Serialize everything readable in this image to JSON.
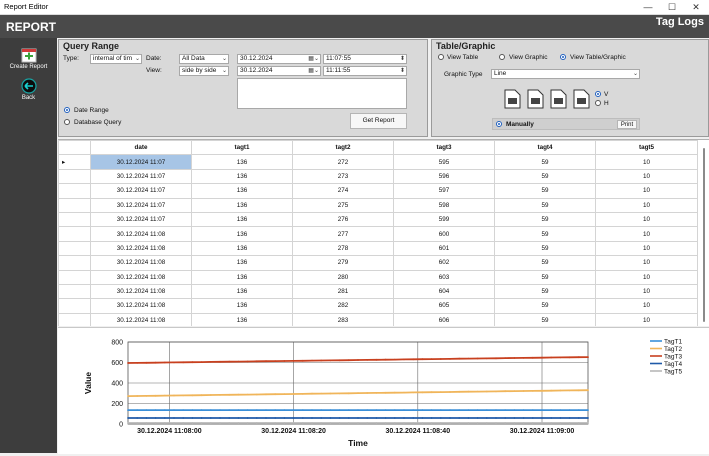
{
  "window": {
    "title": "Report Editor",
    "minimize_glyph": "—",
    "maximize_glyph": "☐",
    "close_glyph": "✕"
  },
  "header": {
    "title": "REPORT",
    "right_title": "Tag Logs"
  },
  "sidebar": {
    "create_label": "Create Report",
    "back_label": "Back",
    "create_icon": "calendar-plus-icon",
    "back_icon": "back-arrow-icon",
    "accent": "#3aa33a"
  },
  "query": {
    "title": "Query Range",
    "type_label": "Type:",
    "type_value": "internal of tim",
    "date_label": "Date:",
    "date_value": "All Data",
    "view_label": "View:",
    "view_value": "side by side",
    "start_date": "30.12.2024",
    "end_date": "30.12.2024",
    "start_time": "11:07:55",
    "end_time": "11:11:55",
    "date_range_label": "Date Range",
    "database_query_label": "Database Query",
    "get_report_label": "Get Report"
  },
  "tablegraphic": {
    "title": "Table/Graphic",
    "view_table_label": "View Table",
    "view_graphic_label": "View Graphic",
    "view_both_label": "View Table/Graphic",
    "graphic_type_label": "Graphic Type",
    "graphic_type_value": "Line",
    "orient_v_label": "V",
    "orient_h_label": "H",
    "manually_label": "Manually",
    "print_label": "Print",
    "export_icons": [
      "pdf-file-icon",
      "csv-file-icon",
      "excel-file-icon",
      "xml-file-icon"
    ]
  },
  "table": {
    "columns": [
      "date",
      "tagt1",
      "tagt2",
      "tagt3",
      "tagt4",
      "tagt5"
    ],
    "rows": [
      [
        "30.12.2024 11:07",
        "136",
        "272",
        "595",
        "59",
        "10"
      ],
      [
        "30.12.2024 11:07",
        "136",
        "273",
        "596",
        "59",
        "10"
      ],
      [
        "30.12.2024 11:07",
        "136",
        "274",
        "597",
        "59",
        "10"
      ],
      [
        "30.12.2024 11:07",
        "136",
        "275",
        "598",
        "59",
        "10"
      ],
      [
        "30.12.2024 11:07",
        "136",
        "276",
        "599",
        "59",
        "10"
      ],
      [
        "30.12.2024 11:08",
        "136",
        "277",
        "600",
        "59",
        "10"
      ],
      [
        "30.12.2024 11:08",
        "136",
        "278",
        "601",
        "59",
        "10"
      ],
      [
        "30.12.2024 11:08",
        "136",
        "279",
        "602",
        "59",
        "10"
      ],
      [
        "30.12.2024 11:08",
        "136",
        "280",
        "603",
        "59",
        "10"
      ],
      [
        "30.12.2024 11:08",
        "136",
        "281",
        "604",
        "59",
        "10"
      ],
      [
        "30.12.2024 11:08",
        "136",
        "282",
        "605",
        "59",
        "10"
      ],
      [
        "30.12.2024 11:08",
        "136",
        "283",
        "606",
        "59",
        "10"
      ]
    ],
    "current_row_marker": "▸",
    "selection_color": "#a7c5e6"
  },
  "chart_data": {
    "type": "line",
    "xlabel": "Time",
    "ylabel": "Value",
    "ylim": [
      0,
      800
    ],
    "yticks": [
      "0",
      "200",
      "400",
      "600",
      "800"
    ],
    "xticks": [
      "30.12.2024 11:08:00",
      "30.12.2024 11:08:20",
      "30.12.2024 11:08:40",
      "30.12.2024 11:09:00"
    ],
    "xtick_positions": [
      0.09,
      0.36,
      0.63,
      0.9
    ],
    "grid": true,
    "legend": "right",
    "series": [
      {
        "name": "TagT1",
        "color": "#3a8fd8",
        "start": 136,
        "end": 136
      },
      {
        "name": "TagT2",
        "color": "#f0b55a",
        "start": 272,
        "end": 330
      },
      {
        "name": "TagT3",
        "color": "#c8401f",
        "start": 595,
        "end": 653
      },
      {
        "name": "TagT4",
        "color": "#1f5aa8",
        "start": 59,
        "end": 59
      },
      {
        "name": "TagT5",
        "color": "#b8b8b8",
        "start": 10,
        "end": 10
      }
    ]
  }
}
